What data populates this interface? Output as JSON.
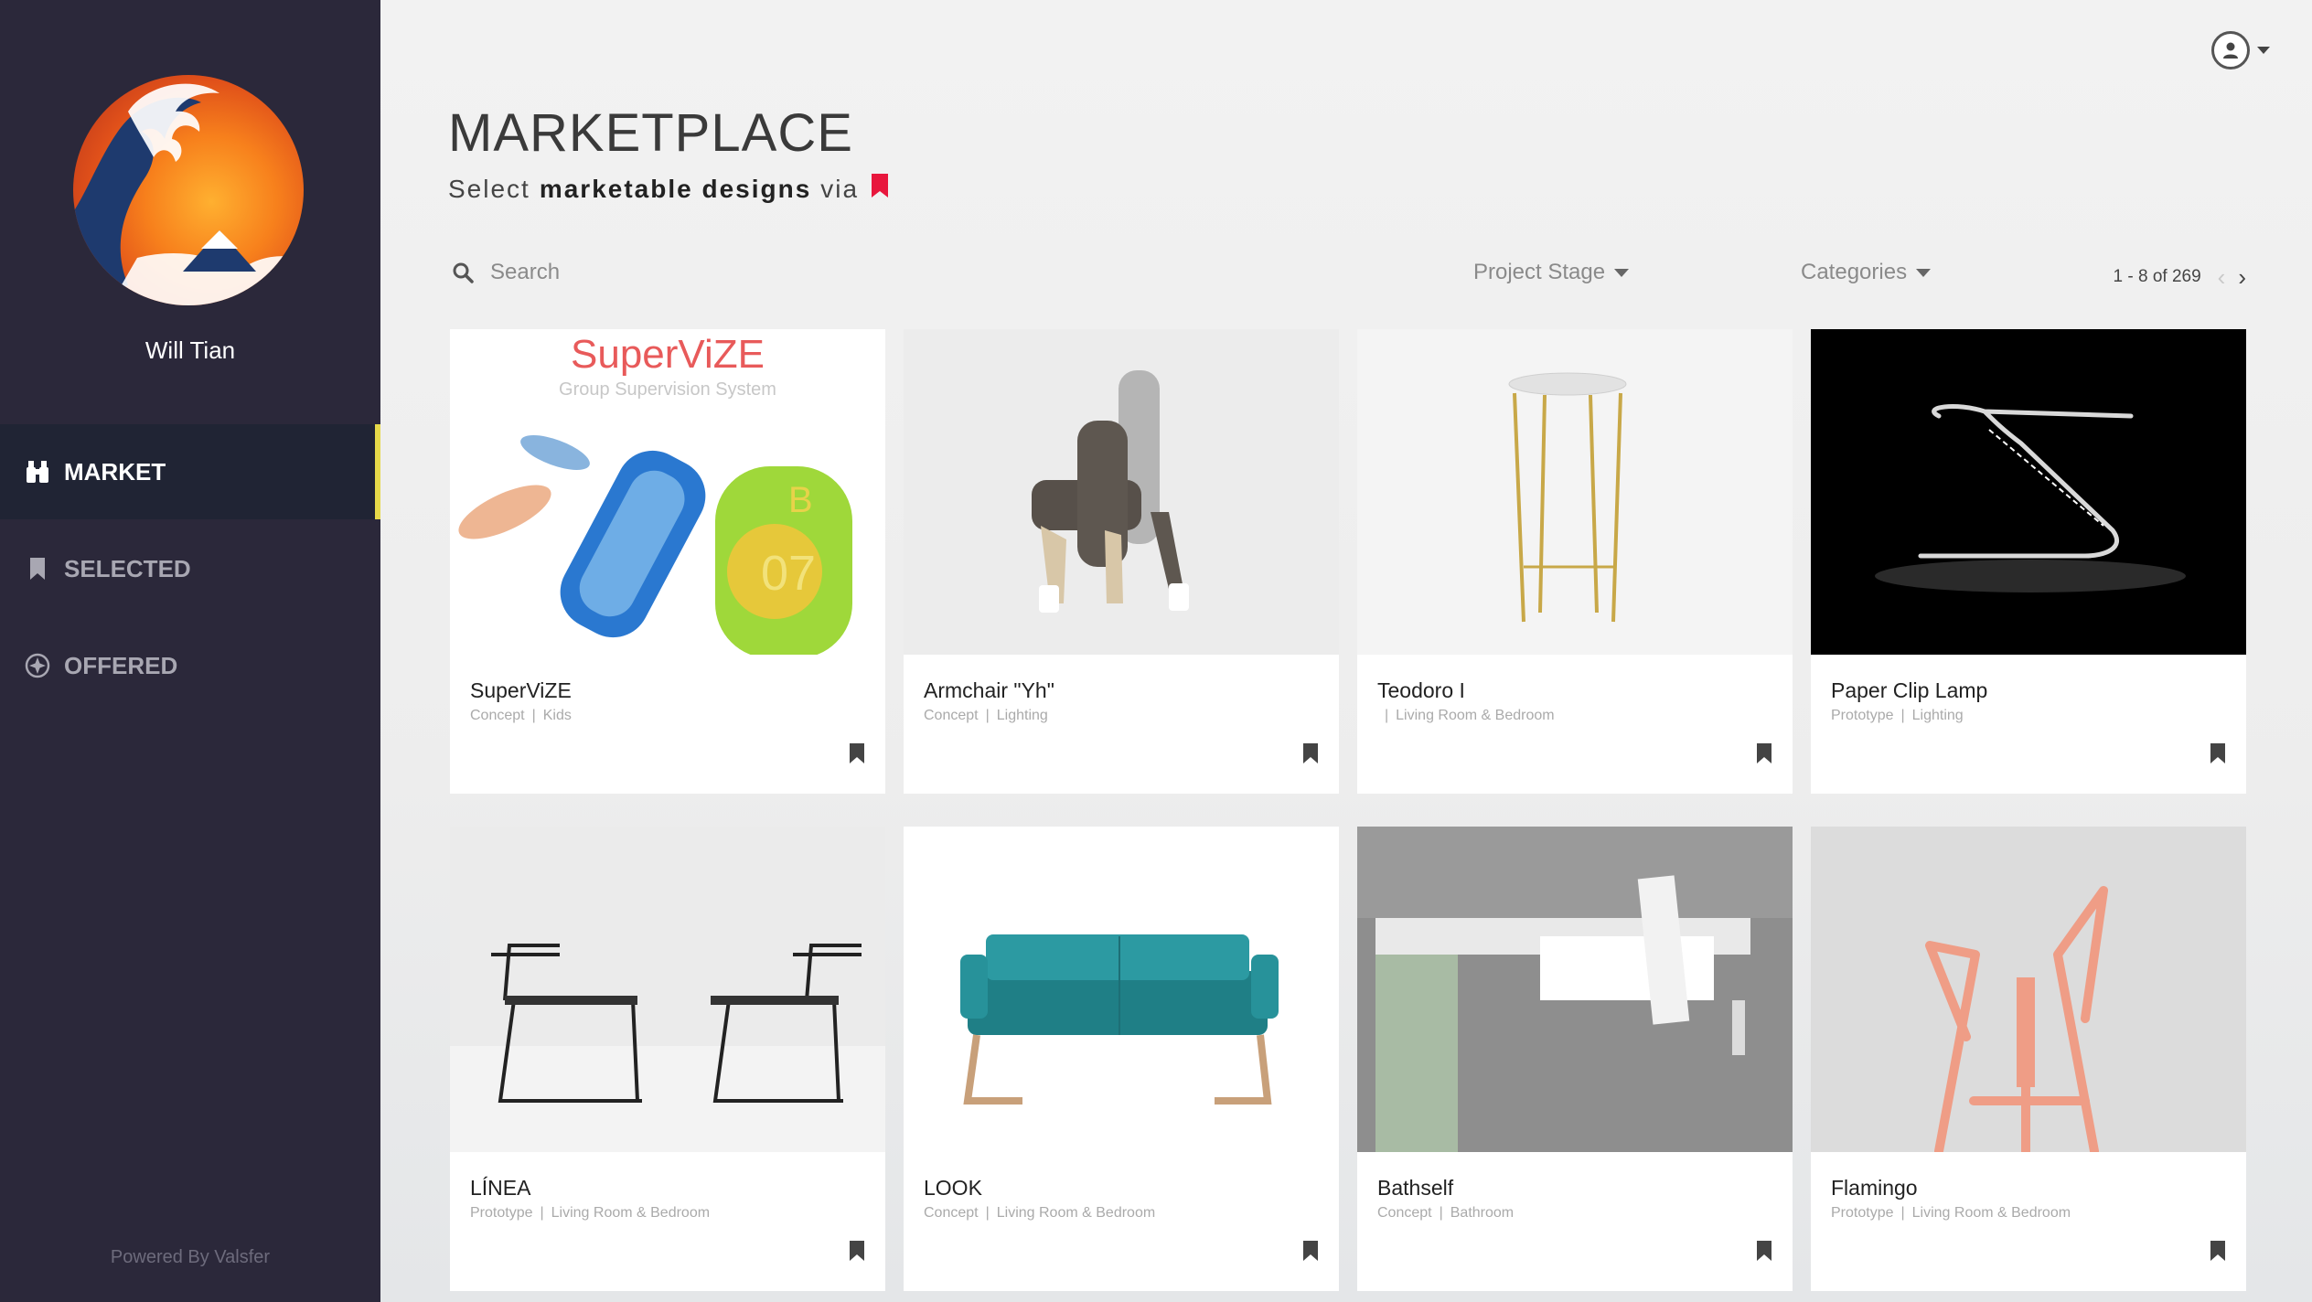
{
  "sidebar": {
    "user_name": "Will Tian",
    "nav": [
      {
        "label": "MARKET",
        "icon": "binoculars-icon",
        "active": true
      },
      {
        "label": "SELECTED",
        "icon": "bookmark-icon",
        "active": false
      },
      {
        "label": "OFFERED",
        "icon": "compass-icon",
        "active": false
      }
    ],
    "powered_by": "Powered By Valsfer"
  },
  "header": {
    "title": "MARKETPLACE",
    "subtitle_pre": "Select",
    "subtitle_bold": "marketable designs",
    "subtitle_post": "via",
    "accent_color": "#e8173d"
  },
  "toolbar": {
    "search_placeholder": "Search",
    "project_stage_label": "Project Stage",
    "categories_label": "Categories",
    "pagination": "1 - 8 of 269"
  },
  "products": [
    {
      "name": "SuperViZE",
      "stage": "Concept",
      "category": "Kids",
      "image_text_title": "SuperViZE",
      "image_text_sub": "Group Supervision System"
    },
    {
      "name": "Armchair \"Yh\"",
      "stage": "Concept",
      "category": "Lighting"
    },
    {
      "name": "Teodoro I",
      "stage": "",
      "category": "Living Room & Bedroom"
    },
    {
      "name": "Paper Clip Lamp",
      "stage": "Prototype",
      "category": "Lighting"
    },
    {
      "name": "LÍNEA",
      "stage": "Prototype",
      "category": "Living Room & Bedroom"
    },
    {
      "name": "LOOK",
      "stage": "Concept",
      "category": "Living Room & Bedroom"
    },
    {
      "name": "Bathself",
      "stage": "Concept",
      "category": "Bathroom"
    },
    {
      "name": "Flamingo",
      "stage": "Prototype",
      "category": "Living Room & Bedroom"
    }
  ]
}
